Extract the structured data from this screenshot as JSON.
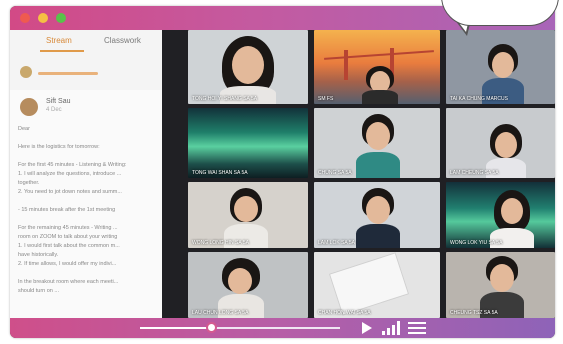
{
  "classroom": {
    "tabs": [
      "Stream",
      "Classwork"
    ],
    "post": {
      "author": "Sift Sau",
      "date": "4 Dec",
      "lines": [
        "Dear",
        "",
        "Here is the logistics for tomorrow:",
        "",
        "For the first 45 minutes - Listening & Writing:",
        "1. I will analyze the questions, introduce ...",
        "together.",
        "2. You need to jot down notes and summ...",
        "",
        "- 15 minutes break after the 1st meeting",
        "",
        "For the remaining 45 minutes - Writing ...",
        "room on ZOOM to talk about your writing",
        "1. I would first talk about the common m...",
        "have historically.",
        "2. If time allows, I would offer my indivi...",
        "",
        "In the breakout room where each meeti...",
        "should turn on ..."
      ]
    }
  },
  "participants": [
    {
      "name": "TONG HOI YI SHANG SA 5A"
    },
    {
      "name": "SM FS"
    },
    {
      "name": "TAI KA CHUNG MARCUS"
    },
    {
      "name": "TONG WAI SHAN SA 5A"
    },
    {
      "name": "CHUNG SA 5A"
    },
    {
      "name": "LAM CHEUNG SA 5A"
    },
    {
      "name": "WONG LONG HIN SA 5A"
    },
    {
      "name": "LAM LOK SA 5A"
    },
    {
      "name": "WONG LOK YIU SA 5A"
    },
    {
      "name": "LAU CHUN LONG SA 5A"
    },
    {
      "name": "CHAN HON WAI SA 5A"
    },
    {
      "name": "CHEUNG TSZ SA 5A"
    }
  ],
  "media": {
    "progress": 0.36
  },
  "colors": {
    "accent_pink": "#d24a86",
    "accent_purple": "#a865b8",
    "stream_tab": "#d88a3a"
  }
}
